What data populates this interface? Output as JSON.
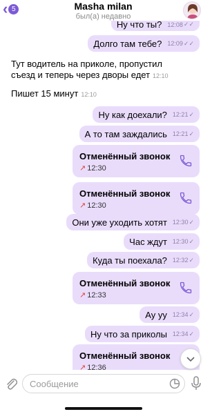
{
  "header": {
    "back_count": "5",
    "contact_name": "Masha milan",
    "status": "был(а) недавно"
  },
  "messages": [
    {
      "type": "out",
      "text": "Ну что ты?",
      "time": "12:08",
      "status": "read"
    },
    {
      "type": "out",
      "text": "Долго там тебе?",
      "time": "12:09",
      "status": "read"
    },
    {
      "type": "in",
      "text": "Тут водитель на приколе, пропустил съезд и теперь через дворы едет",
      "time": "12:10"
    },
    {
      "type": "in",
      "text": "Пишет 15 минут",
      "time": "12:10"
    },
    {
      "type": "out",
      "text": "Ну как доехали?",
      "time": "12:21",
      "status": "delivered"
    },
    {
      "type": "out",
      "text": "А то там заждались",
      "time": "12:21",
      "status": "delivered"
    },
    {
      "type": "call",
      "title": "Отменённый звонок",
      "time": "12:30"
    },
    {
      "type": "call",
      "title": "Отменённый звонок",
      "time": "12:30"
    },
    {
      "type": "out",
      "text": "Они уже уходить хотят",
      "time": "12:30",
      "status": "delivered"
    },
    {
      "type": "out",
      "text": "Час ждут",
      "time": "12:30",
      "status": "delivered"
    },
    {
      "type": "out",
      "text": "Куда ты поехала?",
      "time": "12:32",
      "status": "delivered"
    },
    {
      "type": "call",
      "title": "Отменённый звонок",
      "time": "12:33"
    },
    {
      "type": "out",
      "text": "Ау уу",
      "time": "12:34",
      "status": "delivered"
    },
    {
      "type": "out",
      "text": "Ну что за приколы",
      "time": "12:34",
      "status": "delivered"
    },
    {
      "type": "call",
      "title": "Отменённый звонок",
      "time": "12:36"
    }
  ],
  "input": {
    "placeholder": "Сообщение"
  },
  "icons": {
    "back": "chevron-left-icon",
    "call": "phone-icon",
    "missed_call": "arrow-up-right-icon",
    "attach": "paperclip-icon",
    "sticker": "sticker-icon",
    "mic": "microphone-icon",
    "scroll_down": "chevron-down-icon",
    "read": "double-check-icon",
    "delivered": "single-check-icon"
  },
  "colors": {
    "accent": "#7d5ad6",
    "outgoing_bubble": "#e9dcfb",
    "missed_call": "#e0453b"
  }
}
